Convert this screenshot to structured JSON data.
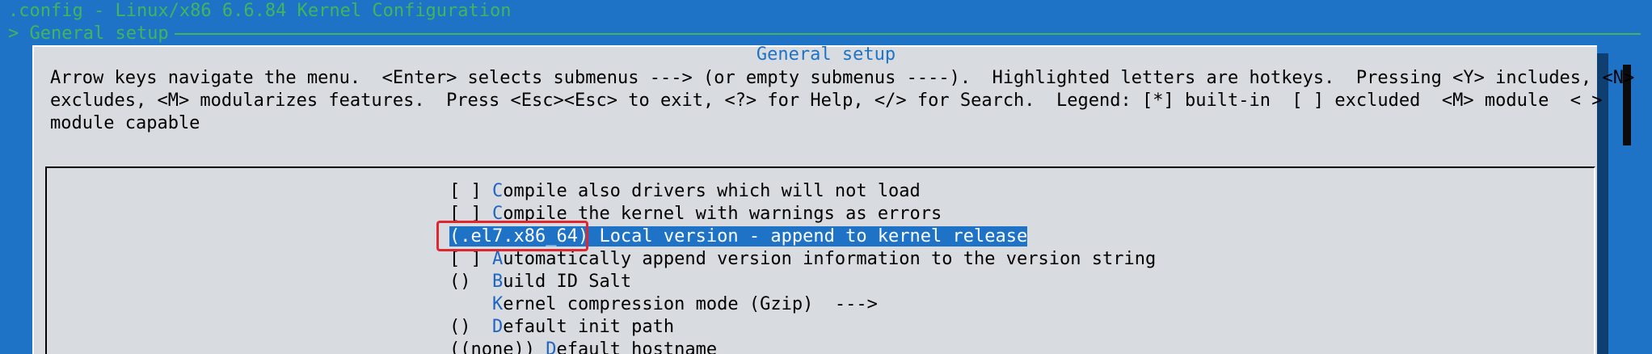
{
  "window": {
    "title": ".config - Linux/x86 6.6.84 Kernel Configuration",
    "breadcrumb": "> General setup"
  },
  "dialog": {
    "title": "General setup",
    "help_lines": [
      "Arrow keys navigate the menu.  <Enter> selects submenus ---> (or empty submenus ----).  Highlighted letters are hotkeys.  Pressing <Y> includes, <N>",
      "excludes, <M> modularizes features.  Press <Esc><Esc> to exit, <?> for Help, </> for Search.  Legend: [*] built-in  [ ] excluded  <M> module  < >",
      "module capable"
    ]
  },
  "menu": {
    "items": [
      {
        "prefix": "[ ] ",
        "hotkey": "C",
        "rest": "ompile also drivers which will not load",
        "selected": false
      },
      {
        "prefix": "[ ] ",
        "hotkey": "C",
        "rest": "ompile the kernel with warnings as errors",
        "selected": false
      },
      {
        "prefix": "(.el7.x86_64) ",
        "hotkey": "L",
        "rest": "ocal version - append to kernel release",
        "selected": true
      },
      {
        "prefix": "[ ] ",
        "hotkey": "A",
        "rest": "utomatically append version information to the version string",
        "selected": false
      },
      {
        "prefix": "()  ",
        "hotkey": "B",
        "rest": "uild ID Salt",
        "selected": false
      },
      {
        "prefix": "    ",
        "hotkey": "K",
        "rest": "ernel compression mode (Gzip)  --->",
        "selected": false
      },
      {
        "prefix": "()  ",
        "hotkey": "D",
        "rest": "efault init path",
        "selected": false
      },
      {
        "prefix": "((none)) ",
        "hotkey": "D",
        "rest": "efault hostname",
        "selected": false
      }
    ]
  },
  "colors": {
    "background": "#1e73c6",
    "dialog": "#d8dbdf",
    "header_text": "#3fb65d",
    "hotkey": "#1f66c4",
    "selection": "#1e73c6",
    "annotation": "#e0262e"
  }
}
